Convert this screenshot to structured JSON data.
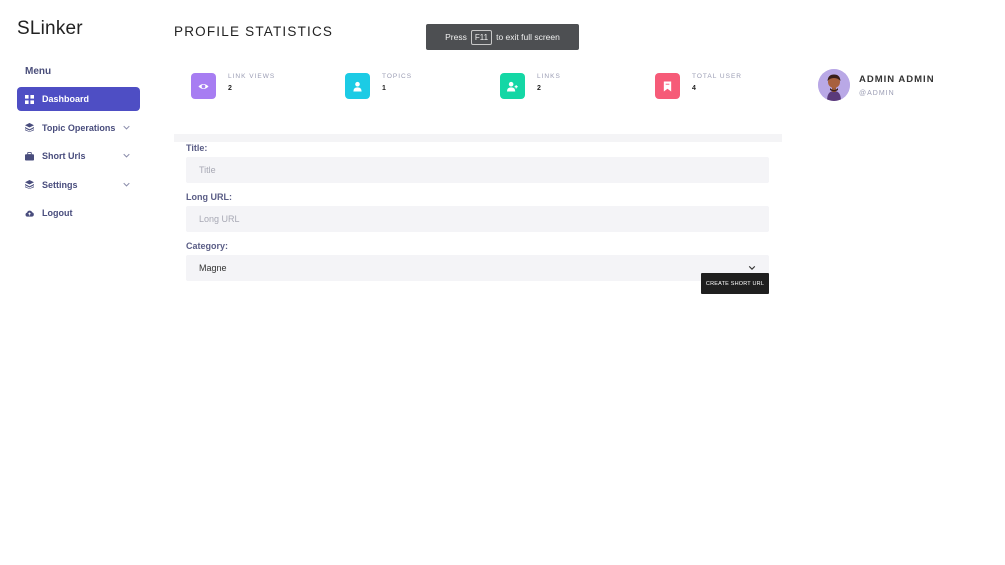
{
  "app": {
    "logo": "SLinker"
  },
  "sidebar": {
    "heading": "Menu",
    "items": [
      {
        "label": "Dashboard",
        "icon": "grid-icon",
        "active": true
      },
      {
        "label": "Topic Operations",
        "icon": "layers-icon",
        "has_submenu": true
      },
      {
        "label": "Short Urls",
        "icon": "briefcase-icon",
        "has_submenu": true
      },
      {
        "label": "Settings",
        "icon": "layers-icon",
        "has_submenu": true
      },
      {
        "label": "Logout",
        "icon": "cloud-icon"
      }
    ]
  },
  "header": {
    "title": "PROFILE STATISTICS"
  },
  "toast": {
    "press": "Press",
    "key": "F11",
    "rest": "to exit full screen"
  },
  "stats": [
    {
      "label": "LINK VIEWS",
      "value": "2",
      "color": "#a77df2",
      "icon": "eye-icon"
    },
    {
      "label": "TOPICS",
      "value": "1",
      "color": "#1ccbe5",
      "icon": "user-icon"
    },
    {
      "label": "LINKS",
      "value": "2",
      "color": "#14d7a5",
      "icon": "user-plus-icon"
    },
    {
      "label": "TOTAL USER",
      "value": "4",
      "color": "#f65b78",
      "icon": "bookmark-icon"
    }
  ],
  "profile": {
    "name": "ADMIN ADMIN",
    "handle": "@ADMIN"
  },
  "form": {
    "title_label": "Title:",
    "title_placeholder": "Title",
    "long_url_label": "Long URL:",
    "long_url_placeholder": "Long URL",
    "category_label": "Category:",
    "category_value": "Magne",
    "submit_label": "CREATE SHORT URL"
  },
  "colors": {
    "accent": "#4e4ec4"
  }
}
